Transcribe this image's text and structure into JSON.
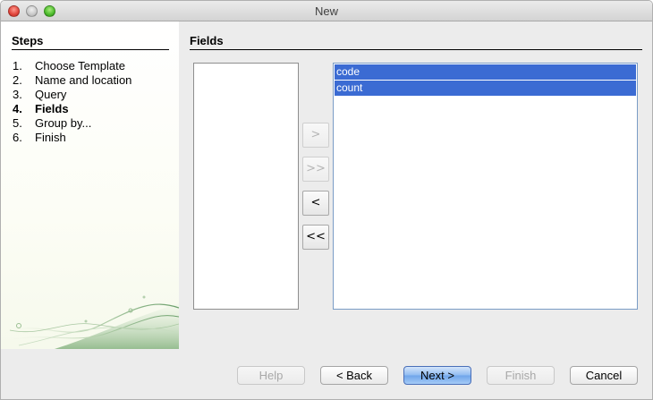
{
  "window": {
    "title": "New"
  },
  "sidebar": {
    "heading": "Steps",
    "steps": [
      {
        "num": "1.",
        "label": "Choose Template"
      },
      {
        "num": "2.",
        "label": "Name and location"
      },
      {
        "num": "3.",
        "label": "Query"
      },
      {
        "num": "4.",
        "label": "Fields",
        "current": true
      },
      {
        "num": "5.",
        "label": "Group by..."
      },
      {
        "num": "6.",
        "label": "Finish"
      }
    ]
  },
  "main": {
    "heading": "Fields",
    "available_fields": [],
    "selected_fields": [
      {
        "label": "code",
        "selected": true
      },
      {
        "label": "count",
        "selected": true
      }
    ],
    "move_buttons": {
      "add": {
        "label": ">",
        "enabled": false
      },
      "add_all": {
        "label": ">>",
        "enabled": false
      },
      "remove": {
        "label": "<",
        "enabled": true
      },
      "remove_all": {
        "label": "<<",
        "enabled": true
      }
    }
  },
  "footer": {
    "help": {
      "label": "Help",
      "enabled": false
    },
    "back": {
      "label": "< Back",
      "enabled": true
    },
    "next": {
      "label": "Next >",
      "enabled": true,
      "default": true
    },
    "finish": {
      "label": "Finish",
      "enabled": false
    },
    "cancel": {
      "label": "Cancel",
      "enabled": true
    }
  },
  "colors": {
    "selection": "#3b6bd3",
    "default_button": "#8fbbf1",
    "sidebar_accent": "#6a9e6a"
  },
  "icons": {
    "traffic_lights": [
      "close-icon",
      "minimize-icon",
      "zoom-icon"
    ]
  }
}
